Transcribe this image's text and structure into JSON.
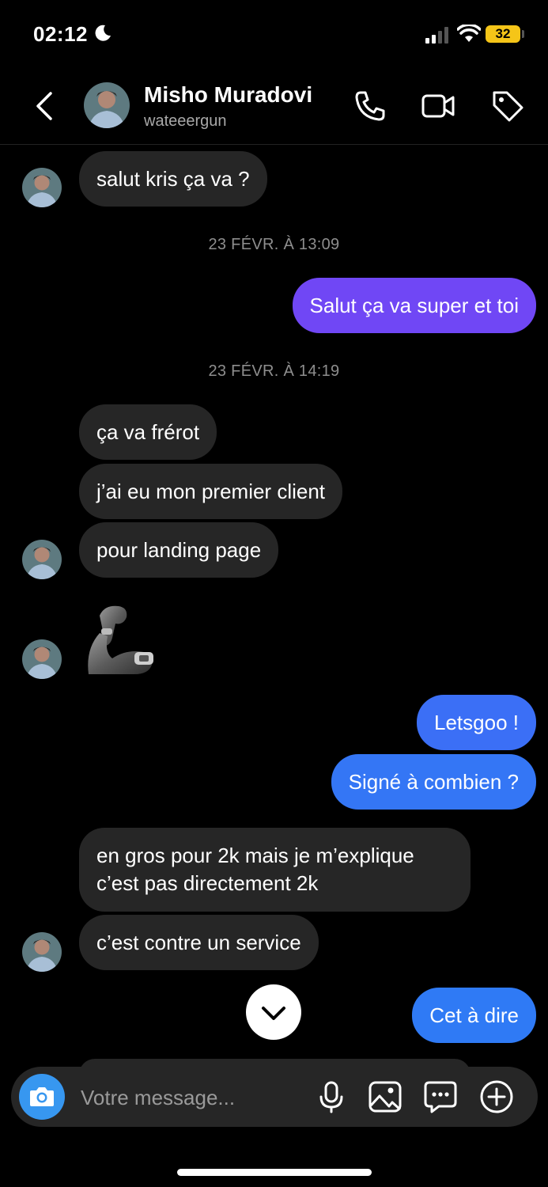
{
  "status_bar": {
    "time": "02:12",
    "battery": "32"
  },
  "header": {
    "name": "Misho Muradovi",
    "username": "wateeergun"
  },
  "messages": {
    "m1": "salut kris ça va ?",
    "date1": "23 FÉVR. À 13:09",
    "m2": "Salut ça va super et toi",
    "date2": "23 FÉVR. À 14:19",
    "m3": "ça va frérot",
    "m4": "j’ai eu mon premier client",
    "m5": "pour landing page",
    "m6": "Letsgoo !",
    "m7": "Signé à combien ?",
    "m8_line1": "en gros pour 2k mais je m’explique",
    "m8_line2": "c’est pas directement 2k",
    "m9": "c’est contre un service",
    "m10": "Cet à dire"
  },
  "composer": {
    "placeholder": "Votre message..."
  },
  "colors": {
    "outgoing_purple": "#7047f5",
    "outgoing_blue": "#3b6ff6",
    "outgoing_blue2": "#2f7af5",
    "camera": "#3797f0"
  }
}
